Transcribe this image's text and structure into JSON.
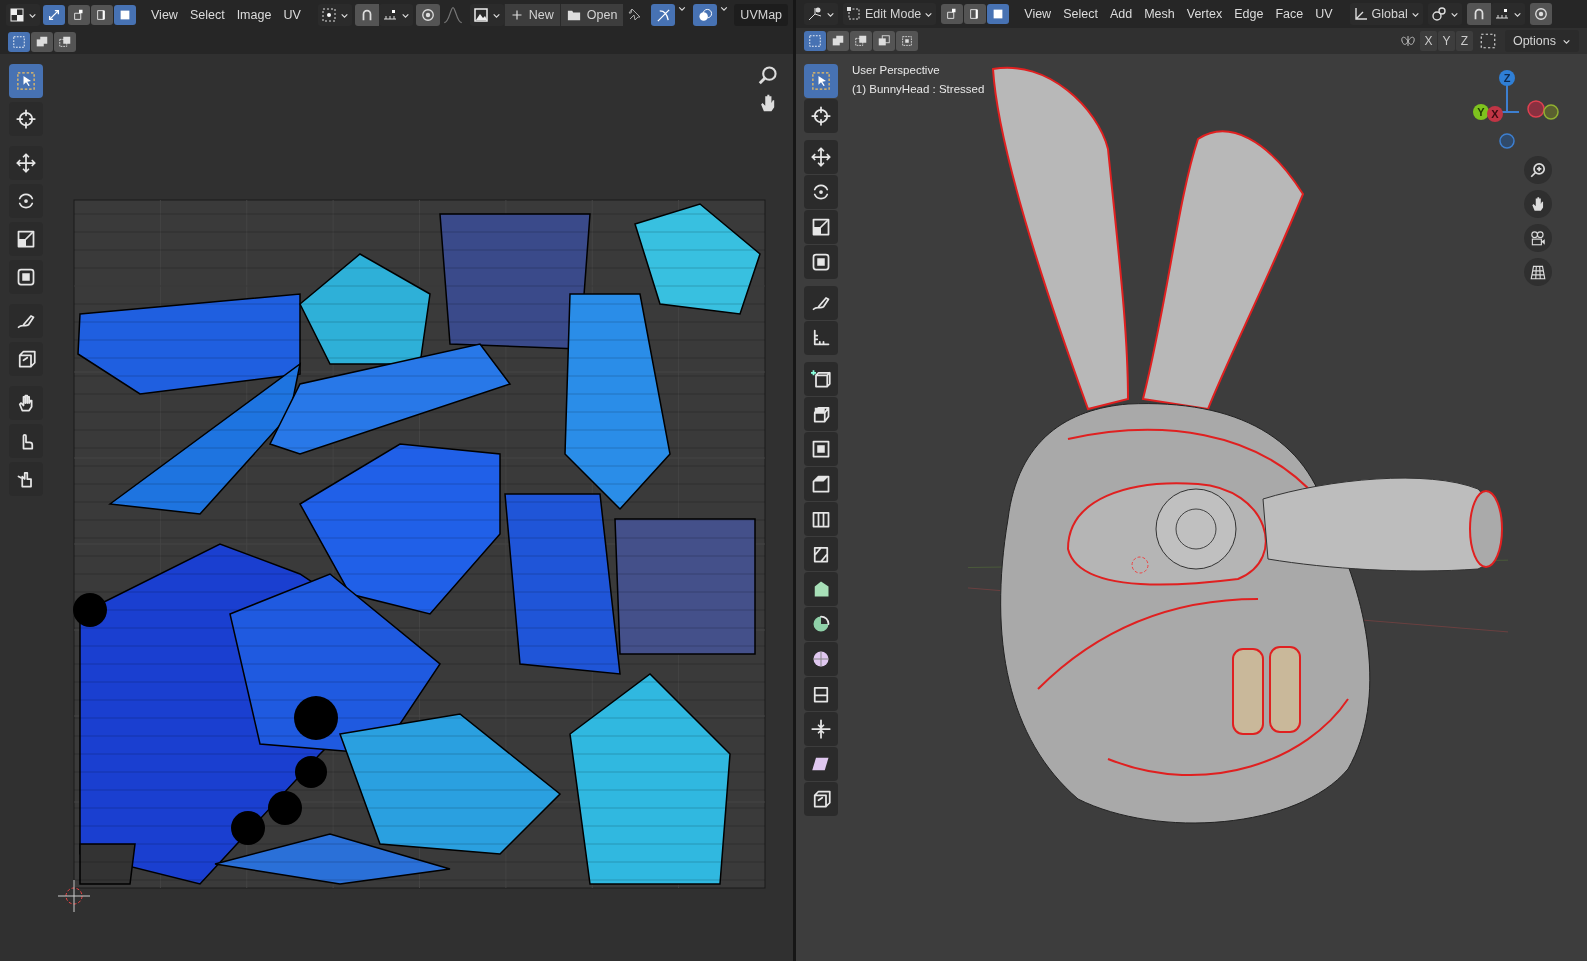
{
  "uv_editor": {
    "header": {
      "sync_selection": true,
      "select_modes": [
        {
          "selected": false
        },
        {
          "selected": false
        },
        {
          "selected": true
        }
      ],
      "menus": [
        "View",
        "Select",
        "Image",
        "UV"
      ],
      "buttons": [
        {
          "label": "New",
          "kind": "new"
        },
        {
          "label": "Open",
          "kind": "open"
        }
      ],
      "uv_map": "UVMap",
      "selection_modes": [
        {
          "selected": true
        },
        {
          "selected": false
        },
        {
          "selected": false
        }
      ]
    },
    "tools": [
      {
        "kind": "select",
        "selected": true
      },
      {
        "kind": "cursor",
        "selected": false
      },
      {
        "kind": "move",
        "selected": false
      },
      {
        "kind": "rotate",
        "selected": false
      },
      {
        "kind": "scale",
        "selected": false
      },
      {
        "kind": "transform",
        "selected": false
      },
      {
        "kind": "annotate",
        "selected": false
      },
      {
        "kind": "rip",
        "selected": false
      },
      {
        "kind": "grab",
        "selected": false
      },
      {
        "kind": "relax",
        "selected": false
      },
      {
        "kind": "pinch",
        "selected": false
      }
    ]
  },
  "viewport": {
    "header": {
      "mode": "Edit Mode",
      "select_modes": [
        {
          "selected": false
        },
        {
          "selected": false
        },
        {
          "selected": true
        }
      ],
      "menus": [
        "View",
        "Select",
        "Add",
        "Mesh",
        "Vertex",
        "Edge",
        "Face",
        "UV"
      ],
      "orientation": "Global",
      "axes": [
        "X",
        "Y",
        "Z"
      ],
      "options": "Options",
      "selection_modes": [
        {
          "selected": true
        },
        {
          "selected": false
        },
        {
          "selected": false
        },
        {
          "selected": false
        },
        {
          "selected": false
        }
      ]
    },
    "overlay_text": [
      "User Perspective",
      "(1) BunnyHead : Stressed"
    ],
    "gizmo_axes": [
      "Z",
      "Y",
      "X"
    ],
    "tools": [
      {
        "kind": "select",
        "selected": true
      },
      {
        "kind": "cursor",
        "selected": false
      },
      {
        "kind": "move",
        "selected": false
      },
      {
        "kind": "rotate",
        "selected": false
      },
      {
        "kind": "scale",
        "selected": false
      },
      {
        "kind": "transform",
        "selected": false
      },
      {
        "kind": "annotate",
        "selected": false
      },
      {
        "kind": "measure",
        "selected": false
      },
      {
        "kind": "add",
        "selected": false
      },
      {
        "kind": "extrude",
        "selected": false
      },
      {
        "kind": "inset",
        "selected": false
      },
      {
        "kind": "bevel",
        "selected": false
      },
      {
        "kind": "loopcut",
        "selected": false
      },
      {
        "kind": "knife",
        "selected": false
      },
      {
        "kind": "polybuild",
        "selected": false
      },
      {
        "kind": "spin",
        "selected": false
      },
      {
        "kind": "smooth",
        "selected": false
      },
      {
        "kind": "slide",
        "selected": false
      },
      {
        "kind": "shrink",
        "selected": false
      },
      {
        "kind": "shear",
        "selected": false
      },
      {
        "kind": "rip",
        "selected": false
      }
    ]
  }
}
